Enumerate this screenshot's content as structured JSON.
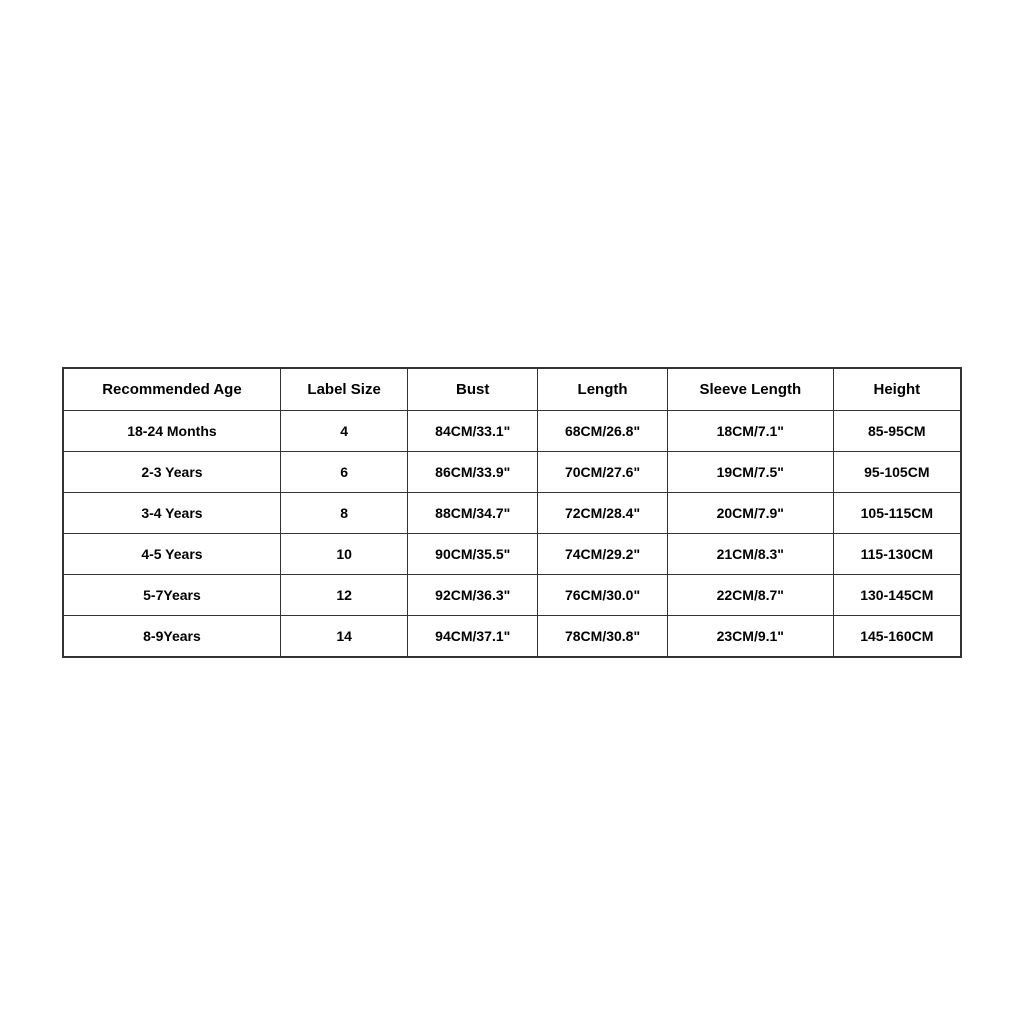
{
  "table": {
    "headers": [
      "Recommended Age",
      "Label Size",
      "Bust",
      "Length",
      "Sleeve Length",
      "Height"
    ],
    "rows": [
      {
        "age": "18-24 Months",
        "label_size": "4",
        "bust": "84CM/33.1\"",
        "length": "68CM/26.8\"",
        "sleeve_length": "18CM/7.1\"",
        "height": "85-95CM"
      },
      {
        "age": "2-3 Years",
        "label_size": "6",
        "bust": "86CM/33.9\"",
        "length": "70CM/27.6\"",
        "sleeve_length": "19CM/7.5\"",
        "height": "95-105CM"
      },
      {
        "age": "3-4 Years",
        "label_size": "8",
        "bust": "88CM/34.7\"",
        "length": "72CM/28.4\"",
        "sleeve_length": "20CM/7.9\"",
        "height": "105-115CM"
      },
      {
        "age": "4-5 Years",
        "label_size": "10",
        "bust": "90CM/35.5\"",
        "length": "74CM/29.2\"",
        "sleeve_length": "21CM/8.3\"",
        "height": "115-130CM"
      },
      {
        "age": "5-7Years",
        "label_size": "12",
        "bust": "92CM/36.3\"",
        "length": "76CM/30.0\"",
        "sleeve_length": "22CM/8.7\"",
        "height": "130-145CM"
      },
      {
        "age": "8-9Years",
        "label_size": "14",
        "bust": "94CM/37.1\"",
        "length": "78CM/30.8\"",
        "sleeve_length": "23CM/9.1\"",
        "height": "145-160CM"
      }
    ]
  }
}
